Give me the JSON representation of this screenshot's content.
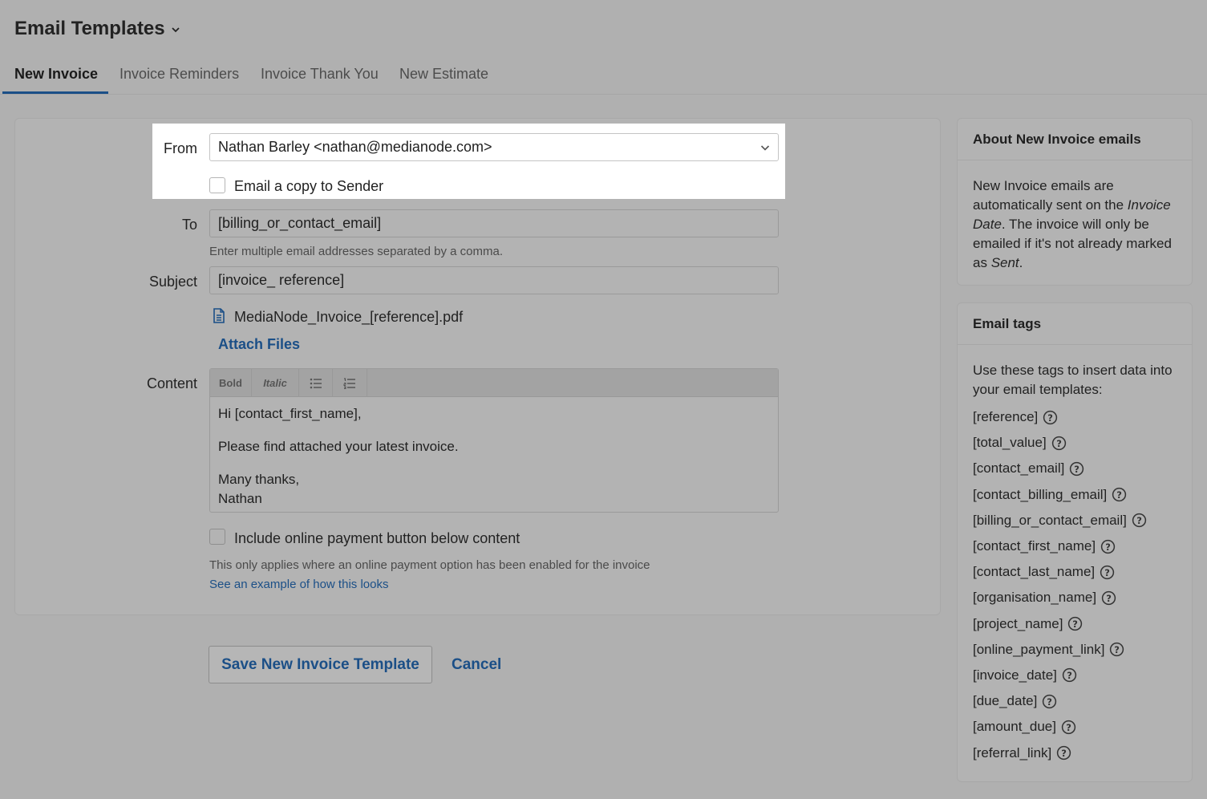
{
  "header": {
    "title": "Email Templates"
  },
  "tabs": [
    {
      "label": "New Invoice",
      "active": true
    },
    {
      "label": "Invoice Reminders",
      "active": false
    },
    {
      "label": "Invoice Thank You",
      "active": false
    },
    {
      "label": "New Estimate",
      "active": false
    }
  ],
  "form": {
    "from_label": "From",
    "from_value": "Nathan Barley <nathan@medianode.com>",
    "copy_sender_label": "Email a copy to Sender",
    "to_label": "To",
    "to_value": "[billing_or_contact_email]",
    "to_hint": "Enter multiple email addresses separated by a comma.",
    "subject_label": "Subject",
    "subject_value": "[invoice_ reference]",
    "attachment_name": "MediaNode_Invoice_[reference].pdf",
    "attach_files_label": "Attach Files",
    "content_label": "Content",
    "toolbar": {
      "bold": "Bold",
      "italic": "Italic"
    },
    "content_lines": [
      "Hi [contact_first_name],",
      "Please find attached your latest invoice.",
      "Many thanks,",
      "Nathan"
    ],
    "payment_button_label": "Include online payment button below content",
    "payment_hint": "This only applies where an online payment option has been enabled for the invoice",
    "example_link": "See an example of how this looks"
  },
  "actions": {
    "save_label": "Save New Invoice Template",
    "cancel_label": "Cancel"
  },
  "about": {
    "title": "About New Invoice emails",
    "text_1": "New Invoice emails are automatically sent on the ",
    "text_em_1": "Invoice Date",
    "text_2": ". The invoice will only be emailed if it's not already marked as ",
    "text_em_2": "Sent",
    "text_3": "."
  },
  "tags": {
    "title": "Email tags",
    "intro": "Use these tags to insert data into your email templates:",
    "items": [
      "[reference]",
      "[total_value]",
      "[contact_email]",
      "[contact_billing_email]",
      "[billing_or_contact_email]",
      "[contact_first_name]",
      "[contact_last_name]",
      "[organisation_name]",
      "[project_name]",
      "[online_payment_link]",
      "[invoice_date]",
      "[due_date]",
      "[amount_due]",
      "[referral_link]"
    ]
  },
  "colors": {
    "accent": "#1b4f87",
    "overlay_bg": "#b0b0b0",
    "highlight_bg": "#ffffff"
  }
}
